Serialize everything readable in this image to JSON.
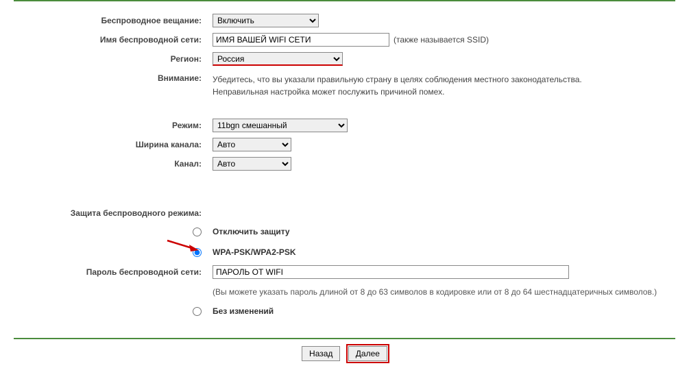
{
  "labels": {
    "wireless_radio": "Беспроводное вещание:",
    "ssid": "Имя беспроводной сети:",
    "region": "Регион:",
    "attention": "Внимание:",
    "mode": "Режим:",
    "channel_width": "Ширина канала:",
    "channel": "Канал:",
    "security": "Защита беспроводного режима:",
    "password": "Пароль беспроводной сети:"
  },
  "values": {
    "wireless_radio": "Включить",
    "ssid": "ИМЯ ВАШЕЙ WIFI СЕТИ",
    "region": "Россия",
    "mode": "11bgn смешанный",
    "channel_width": "Авто",
    "channel": "Авто",
    "password": "ПАРОЛЬ ОТ WIFI"
  },
  "hints": {
    "ssid_aka": "(также называется SSID)",
    "attention_text": "Убедитесь, что вы указали правильную страну в целях соблюдения местного законодательства. Неправильная настройка может послужить причиной помех.",
    "password_hint": "(Вы можете указать пароль длиной от 8 до 63 символов в кодировке или от 8 до 64 шестнадцатеричных символов.)"
  },
  "security_options": {
    "disable": "Отключить защиту",
    "wpa": "WPA-PSK/WPA2-PSK",
    "nochange": "Без изменений"
  },
  "buttons": {
    "back": "Назад",
    "next": "Далее"
  }
}
